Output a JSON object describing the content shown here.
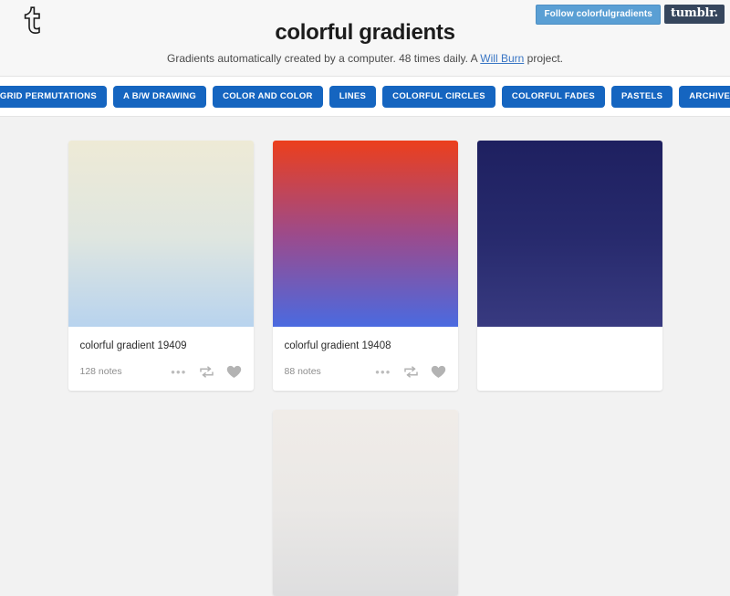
{
  "header": {
    "logo_icon": "tumblr-t-icon",
    "follow_button": "Follow colorfulgradients",
    "tumblr_badge": "tumblr.",
    "title": "colorful gradients",
    "description_before": "Gradients automatically created by a computer. 48 times daily. A ",
    "description_link": "Will Burn",
    "description_after": " project.",
    "link_color": "#3a76c4"
  },
  "nav": {
    "items": [
      {
        "label": "GRID PERMUTATIONS"
      },
      {
        "label": "A B/W DRAWING"
      },
      {
        "label": "COLOR AND COLOR"
      },
      {
        "label": "LINES"
      },
      {
        "label": "COLORFUL CIRCLES"
      },
      {
        "label": "COLORFUL FADES"
      },
      {
        "label": "PASTELS"
      },
      {
        "label": "ARCHIVE"
      }
    ],
    "button_color": "#1565c0"
  },
  "posts": [
    {
      "caption": "colorful gradient 19409",
      "notes": "128 notes",
      "gradient_top": "#eeead6",
      "gradient_mid": "#dfe6e0",
      "gradient_bottom": "#b8d3ee",
      "actions": {
        "more": "•••",
        "reblog": "reblog-icon",
        "like": "heart-icon"
      }
    },
    {
      "caption": "colorful gradient 19408",
      "notes": "88 notes",
      "gradient_top": "#ec3f1c",
      "gradient_mid": "#9a4b8e",
      "gradient_bottom": "#4a6ae0",
      "actions": {
        "more": "•••",
        "reblog": "reblog-icon",
        "like": "heart-icon"
      }
    },
    {
      "caption": "",
      "notes": "",
      "gradient_top": "#1e2060",
      "gradient_mid": "#272a6d",
      "gradient_bottom": "#383a80",
      "actions": {
        "more": "",
        "reblog": "",
        "like": ""
      }
    },
    {
      "caption": "",
      "notes": "",
      "gradient_top": "#f0ece8",
      "gradient_mid": "#eae8e6",
      "gradient_bottom": "#dededf",
      "actions": {
        "more": "",
        "reblog": "",
        "like": ""
      }
    }
  ]
}
